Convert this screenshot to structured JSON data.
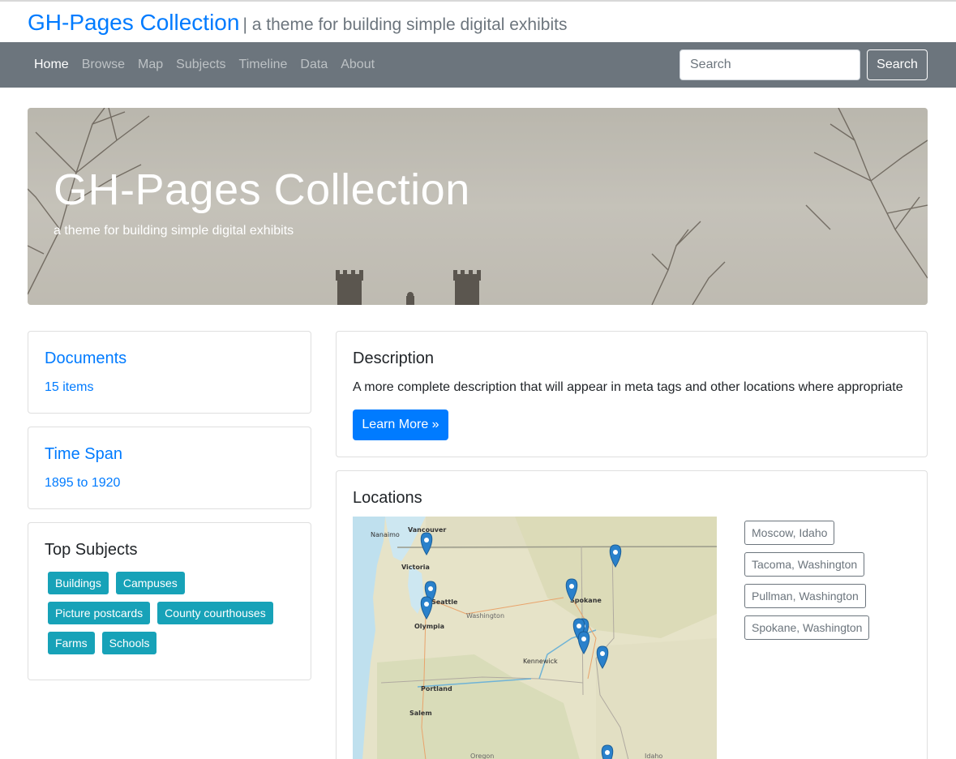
{
  "header": {
    "title": "GH-Pages Collection",
    "tagline": "| a theme for building simple digital exhibits"
  },
  "nav": {
    "items": [
      {
        "label": "Home",
        "active": true
      },
      {
        "label": "Browse",
        "active": false
      },
      {
        "label": "Map",
        "active": false
      },
      {
        "label": "Subjects",
        "active": false
      },
      {
        "label": "Timeline",
        "active": false
      },
      {
        "label": "Data",
        "active": false
      },
      {
        "label": "About",
        "active": false
      }
    ],
    "search_placeholder": "Search",
    "search_button": "Search"
  },
  "hero": {
    "title": "GH-Pages Collection",
    "subtitle": "a theme for building simple digital exhibits"
  },
  "documents": {
    "title": "Documents",
    "value": "15 items"
  },
  "time_span": {
    "title": "Time Span",
    "value": "1895 to 1920"
  },
  "top_subjects": {
    "title": "Top Subjects",
    "tags": [
      "Buildings",
      "Campuses",
      "Picture postcards",
      "County courthouses",
      "Farms",
      "Schools"
    ]
  },
  "description": {
    "title": "Description",
    "text": "A more complete description that will appear in meta tags and other locations where appropriate",
    "button": "Learn More »"
  },
  "locations": {
    "title": "Locations",
    "items": [
      "Moscow, Idaho",
      "Tacoma, Washington",
      "Pullman, Washington",
      "Spokane, Washington"
    ],
    "map_labels": {
      "vancouver": "Vancouver",
      "nanaimo": "Nanaimo",
      "victoria": "Victoria",
      "seattle": "Seattle",
      "olympia": "Olympia",
      "washington": "Washington",
      "spokane": "Spokane",
      "kennewick": "Kennewick",
      "portland": "Portland",
      "salem": "Salem",
      "oregon": "Oregon",
      "idaho": "Idaho"
    }
  },
  "colors": {
    "link": "#007bff",
    "navbar": "#6c757d",
    "tag": "#17a2b8",
    "marker": "#2a81cb"
  }
}
